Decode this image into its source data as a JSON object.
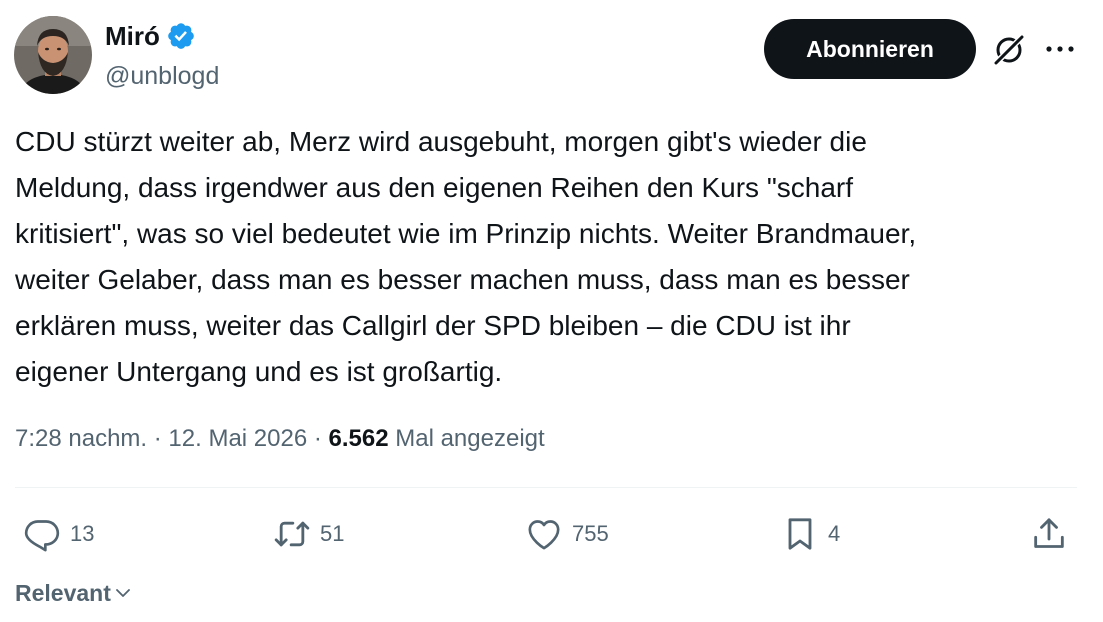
{
  "author": {
    "display_name": "Miró",
    "handle": "@unblogd",
    "verified": true
  },
  "header": {
    "follow_label": "Abonnieren",
    "icons": [
      "grok-icon",
      "more-icon"
    ]
  },
  "tweet": {
    "text": "CDU stürzt weiter ab, Merz wird ausgebuht, morgen gibt's wieder die\nMeldung, dass irgendwer aus den eigenen Reihen den Kurs \"scharf\nkritisiert\", was so viel bedeutet wie im Prinzip nichts. Weiter Brandmauer,\nweiter Gelaber, dass man es besser machen muss, dass man es besser\nerklären muss, weiter das Callgirl der SPD bleiben – die CDU ist ihr\neigener Untergang und es ist großartig.",
    "time": "7:28 nachm.",
    "separator": " · ",
    "date": "12. Mai 2026",
    "views_count": "6.562",
    "views_label": " Mal angezeigt"
  },
  "actions": {
    "reply_count": "13",
    "retweet_count": "51",
    "like_count": "755",
    "bookmark_count": "4"
  },
  "replies": {
    "sort_label": "Relevant"
  },
  "colors": {
    "text": "#0f1419",
    "secondary": "#536471",
    "verified": "#1d9bf0",
    "button_bg": "#0f1419",
    "divider": "#eff3f4"
  }
}
